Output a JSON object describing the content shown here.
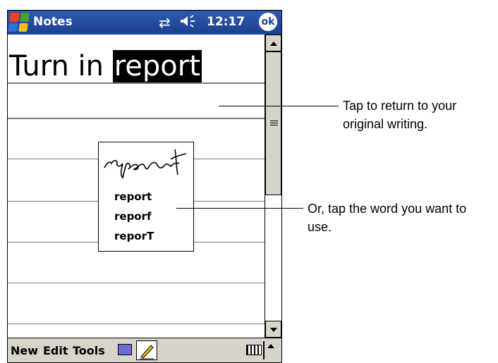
{
  "titlebar": {
    "app_title": "Notes",
    "time": "12:17",
    "ok_label": "ok",
    "icons": [
      "windows-start-flag-icon",
      "connectivity-icon",
      "speaker-icon"
    ]
  },
  "note": {
    "typed_prefix": "Turn in ",
    "typed_selected": "report"
  },
  "correction_popup": {
    "ink_word": "report",
    "alternates": [
      "report",
      "reporf",
      "reporT"
    ]
  },
  "menubar": {
    "items": [
      "New",
      "Edit",
      "Tools"
    ],
    "icons": [
      "recording-icon",
      "pen-icon",
      "keyboard-icon",
      "input-panel-arrow-icon"
    ]
  },
  "callouts": [
    "Tap to return to your original writing.",
    "Or, tap the word you want to use."
  ],
  "colors": {
    "titlebar_blue": "#1c3f8f",
    "bar_gray": "#d8d4cc",
    "flag_red": "#e8401e",
    "flag_green": "#4aa02c",
    "flag_blue": "#2f6fd8",
    "flag_yellow": "#f4c01c"
  }
}
